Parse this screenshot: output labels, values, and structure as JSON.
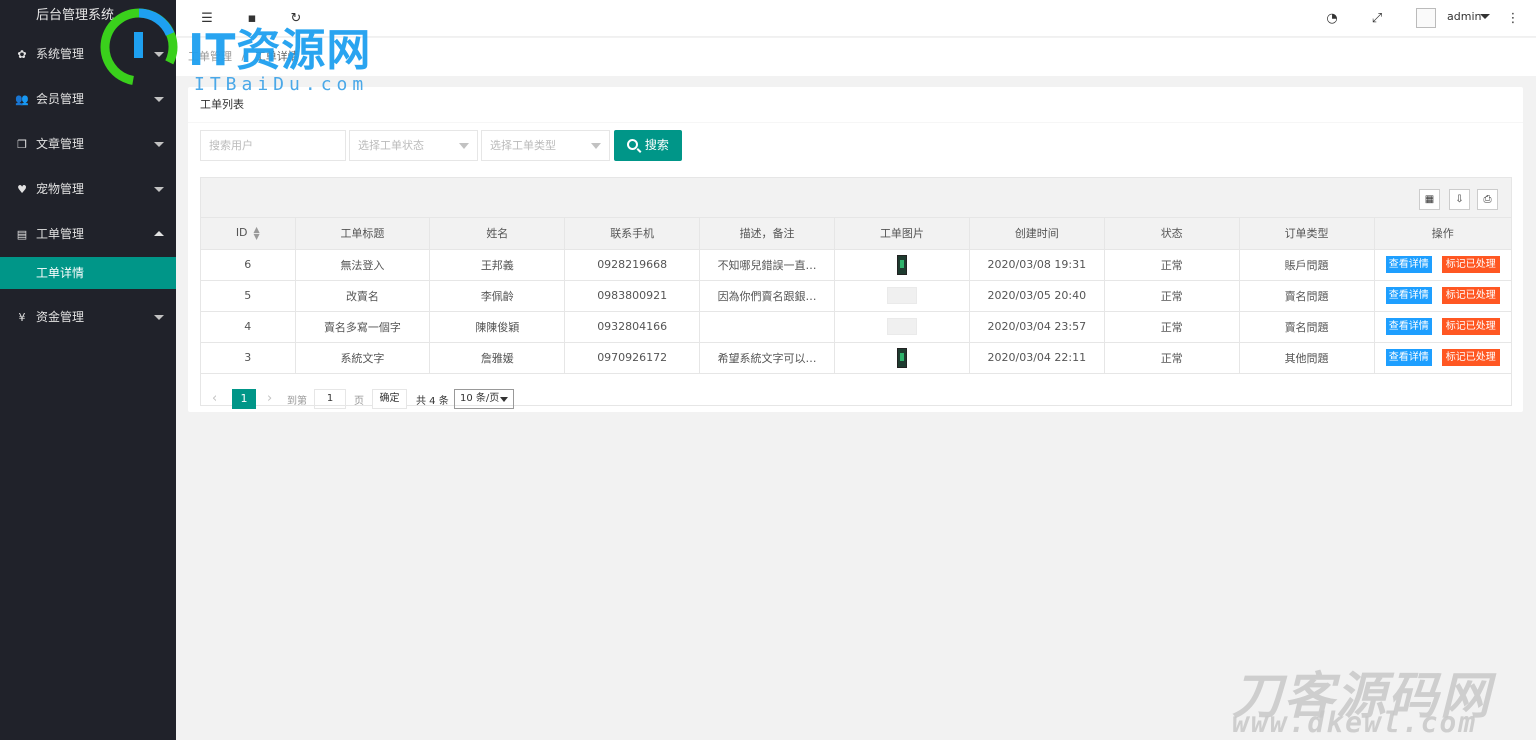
{
  "sidebar": {
    "brand": "后台管理系统",
    "items": [
      {
        "label": "系统管理",
        "icon": "gear-icon"
      },
      {
        "label": "会员管理",
        "icon": "users-icon"
      },
      {
        "label": "文章管理",
        "icon": "copy-icon"
      },
      {
        "label": "宠物管理",
        "icon": "heart-icon"
      },
      {
        "label": "工单管理",
        "icon": "document-icon"
      },
      {
        "label": "资金管理",
        "icon": "yen-icon"
      }
    ],
    "active_sub": "工单详情"
  },
  "header": {
    "user": "admin"
  },
  "breadcrumb": {
    "parent": "工单管理",
    "separator": "/",
    "current": "工单详情"
  },
  "card": {
    "title": "工单列表"
  },
  "search": {
    "user_placeholder": "搜索用户",
    "status_placeholder": "选择工单状态",
    "type_placeholder": "选择工单类型",
    "button": "搜索"
  },
  "table": {
    "columns": [
      "ID",
      "工单标题",
      "姓名",
      "联系手机",
      "描述，备注",
      "工单图片",
      "创建时间",
      "状态",
      "订单类型",
      "操作"
    ],
    "rows": [
      {
        "id": "6",
        "title": "無法登入",
        "name": "王邦義",
        "phone": "0928219668",
        "desc": "不知哪兒錯誤一直…",
        "img": "phone",
        "created": "2020/03/08 19:31",
        "status": "正常",
        "type": "賬戶問題"
      },
      {
        "id": "5",
        "title": "改賣名",
        "name": "李佩齡",
        "phone": "0983800921",
        "desc": "因為你們賣名跟銀…",
        "img": "placeholder",
        "created": "2020/03/05 20:40",
        "status": "正常",
        "type": "賣名問題"
      },
      {
        "id": "4",
        "title": "賣名多寫一個字",
        "name": "陳陳俊穎",
        "phone": "0932804166",
        "desc": "",
        "img": "placeholder",
        "created": "2020/03/04 23:57",
        "status": "正常",
        "type": "賣名問題"
      },
      {
        "id": "3",
        "title": "系統文字",
        "name": "詹雅媛",
        "phone": "0970926172",
        "desc": "希望系統文字可以…",
        "img": "phone",
        "created": "2020/03/04 22:11",
        "status": "正常",
        "type": "其他問題"
      }
    ],
    "view_label": "查看详情",
    "mark_label": "标记已处理"
  },
  "pager": {
    "current": "1",
    "goto_label": "到第",
    "page_input": "1",
    "page_unit": "页",
    "confirm": "确定",
    "total": "共 4 条",
    "page_size": "10 条/页"
  },
  "watermarks": {
    "logo_text": "IT资源网",
    "logo_sub": "ITBaiDu.com",
    "corner_text": "刀客源码网",
    "corner_sub": "www.dkewl.com"
  },
  "colors": {
    "sidebar_bg": "#20222a",
    "accent": "#009688",
    "view_btn": "#1e9fff",
    "mark_btn": "#ff5722"
  }
}
